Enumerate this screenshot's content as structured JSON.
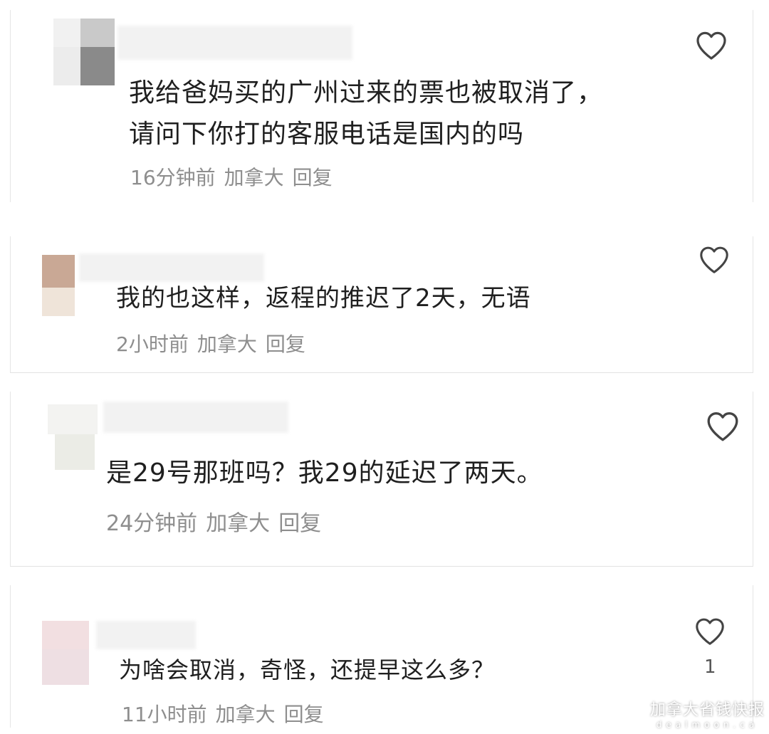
{
  "comments": [
    {
      "text_lines": [
        "我给爸妈买的广州过来的票也被取消了，",
        "请问下你打的客服电话是国内的吗"
      ],
      "time": "16分钟前",
      "location": "加拿大",
      "reply": "回复"
    },
    {
      "text_lines": [
        "我的也这样，返程的推迟了2天，无语"
      ],
      "time": "2小时前",
      "location": "加拿大",
      "reply": "回复"
    },
    {
      "text_lines": [
        "是29号那班吗？我29的延迟了两天。"
      ],
      "time": "24分钟前",
      "location": "加拿大",
      "reply": "回复"
    },
    {
      "text_lines": [
        "为啥会取消，奇怪，还提早这么多？"
      ],
      "time": "11小时前",
      "location": "加拿大",
      "reply": "回复",
      "likes": "1"
    }
  ],
  "watermark": {
    "main": "加拿大省钱快报",
    "sub": "dealmoon.ca"
  },
  "icons": {
    "like": "heart-icon"
  },
  "colors": {
    "text": "#1f1f1f",
    "meta": "#8e8e8e",
    "heart": "#444444"
  }
}
